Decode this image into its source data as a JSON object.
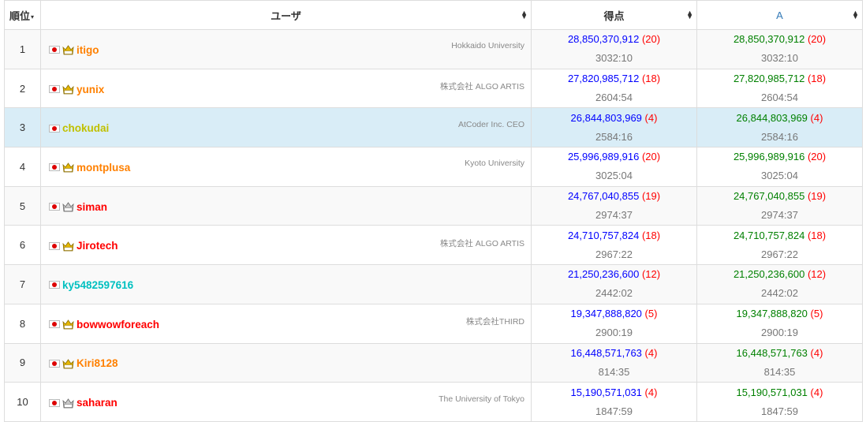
{
  "header": {
    "rank": "順位",
    "rank_caret": "▾",
    "user": "ユーザ",
    "score": "得点",
    "task_a": "A"
  },
  "rows": [
    {
      "rank": "1",
      "user": "itigo",
      "color": "orange",
      "crown": "100",
      "affiliation": "Hokkaido University",
      "score": "28,850,370,912",
      "penalty": "(20)",
      "time": "3032:10",
      "a_score": "28,850,370,912",
      "a_penalty": "(20)",
      "a_time": "3032:10"
    },
    {
      "rank": "2",
      "user": "yunix",
      "color": "orange",
      "crown": "100",
      "affiliation": "株式会社 ALGO ARTIS",
      "score": "27,820,985,712",
      "penalty": "(18)",
      "time": "2604:54",
      "a_score": "27,820,985,712",
      "a_penalty": "(18)",
      "a_time": "2604:54"
    },
    {
      "rank": "3",
      "user": "chokudai",
      "color": "yellow",
      "crown": "",
      "affiliation": "AtCoder Inc. CEO",
      "score": "26,844,803,969",
      "penalty": "(4)",
      "time": "2584:16",
      "a_score": "26,844,803,969",
      "a_penalty": "(4)",
      "a_time": "2584:16"
    },
    {
      "rank": "4",
      "user": "montplusa",
      "color": "orange",
      "crown": "100",
      "affiliation": "Kyoto University",
      "score": "25,996,989,916",
      "penalty": "(20)",
      "time": "3025:04",
      "a_score": "25,996,989,916",
      "a_penalty": "(20)",
      "a_time": "3025:04"
    },
    {
      "rank": "5",
      "user": "siman",
      "color": "red",
      "crown": "30",
      "affiliation": "",
      "score": "24,767,040,855",
      "penalty": "(19)",
      "time": "2974:37",
      "a_score": "24,767,040,855",
      "a_penalty": "(19)",
      "a_time": "2974:37"
    },
    {
      "rank": "6",
      "user": "Jirotech",
      "color": "red",
      "crown": "10",
      "affiliation": "株式会社 ALGO ARTIS",
      "score": "24,710,757,824",
      "penalty": "(18)",
      "time": "2967:22",
      "a_score": "24,710,757,824",
      "a_penalty": "(18)",
      "a_time": "2967:22"
    },
    {
      "rank": "7",
      "user": "ky5482597616",
      "color": "cyan",
      "crown": "",
      "affiliation": "",
      "score": "21,250,236,600",
      "penalty": "(12)",
      "time": "2442:02",
      "a_score": "21,250,236,600",
      "a_penalty": "(12)",
      "a_time": "2442:02"
    },
    {
      "rank": "8",
      "user": "bowwowforeach",
      "color": "red",
      "crown": "10",
      "affiliation": "株式会社THIRD",
      "score": "19,347,888,820",
      "penalty": "(5)",
      "time": "2900:19",
      "a_score": "19,347,888,820",
      "a_penalty": "(5)",
      "a_time": "2900:19"
    },
    {
      "rank": "9",
      "user": "Kiri8128",
      "color": "orange",
      "crown": "100",
      "affiliation": "",
      "score": "16,448,571,763",
      "penalty": "(4)",
      "time": "814:35",
      "a_score": "16,448,571,763",
      "a_penalty": "(4)",
      "a_time": "814:35"
    },
    {
      "rank": "10",
      "user": "saharan",
      "color": "red",
      "crown": "30",
      "affiliation": "The University of Tokyo",
      "score": "15,190,571,031",
      "penalty": "(4)",
      "time": "1847:59",
      "a_score": "15,190,571,031",
      "a_penalty": "(4)",
      "a_time": "1847:59"
    }
  ],
  "colors": {
    "orange": "#ff8000",
    "red": "#ff0000",
    "yellow": "#c0c000",
    "cyan": "#00c0c0",
    "score_blue": "#0000ff",
    "score_green": "#008000",
    "penalty_red": "#ff0000",
    "highlight_row": "#d9edf7"
  },
  "icons": {
    "flag": "japan-flag-icon",
    "crown_100": "crown-gold-100-icon",
    "crown_30": "crown-silver-30-icon",
    "crown_10": "crown-gold-10-icon",
    "sort": "sort-up-down-icon"
  }
}
